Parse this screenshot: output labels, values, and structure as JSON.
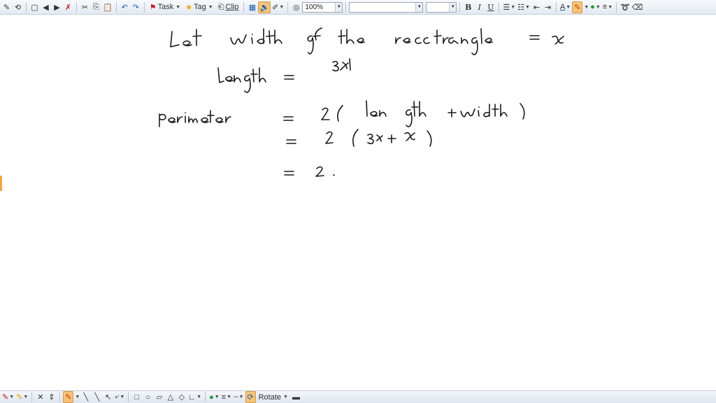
{
  "toolbar": {
    "task_label": "Task",
    "tag_label": "Tag",
    "clip_label": "Clip",
    "zoom_value": "100%",
    "font_name_value": "",
    "font_size_value": "",
    "bold_label": "B",
    "italic_label": "I",
    "underline_label": "U",
    "font_color_label": "A"
  },
  "bottom_toolbar": {
    "rotate_label": "Rotate"
  },
  "colors": {
    "pen_highlight": "#f6c37a",
    "ink": "#1a1a1a",
    "toolbar_bg": "#e4eaf2"
  },
  "note_lines": [
    "Let width of the rectangle = x",
    "length = 3x",
    "Perimeter = 2( length + width)",
    "= 2 ( 3x + x)",
    "= 2"
  ]
}
